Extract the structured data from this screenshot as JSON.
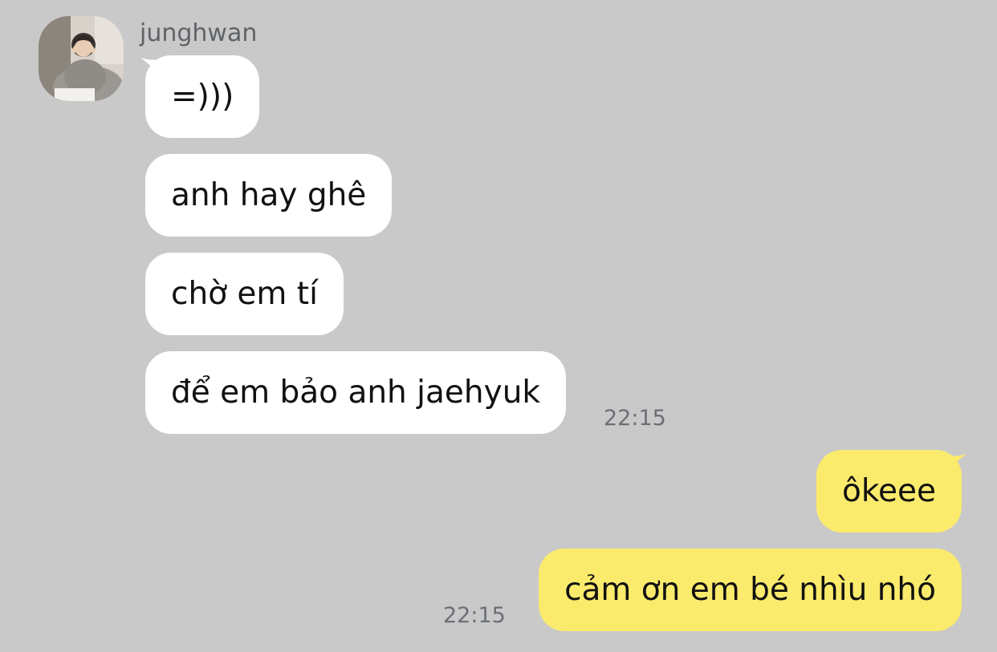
{
  "chat": {
    "contact_name": "junghwan",
    "incoming_messages": [
      {
        "text": "=)))"
      },
      {
        "text": "anh hay ghê"
      },
      {
        "text": "chờ em tí"
      },
      {
        "text": "để em bảo anh jaehyuk"
      }
    ],
    "incoming_time": "22:15",
    "outgoing_messages": [
      {
        "text": "ôkeee"
      },
      {
        "text": "cảm ơn em bé nhìu nhó"
      }
    ],
    "outgoing_time": "22:15"
  },
  "colors": {
    "background": "#c9c9c9",
    "incoming_bubble": "#ffffff",
    "outgoing_bubble": "#fbeb6c",
    "meta_text": "#6b6f75"
  },
  "icons": {
    "avatar": "profile-photo"
  }
}
